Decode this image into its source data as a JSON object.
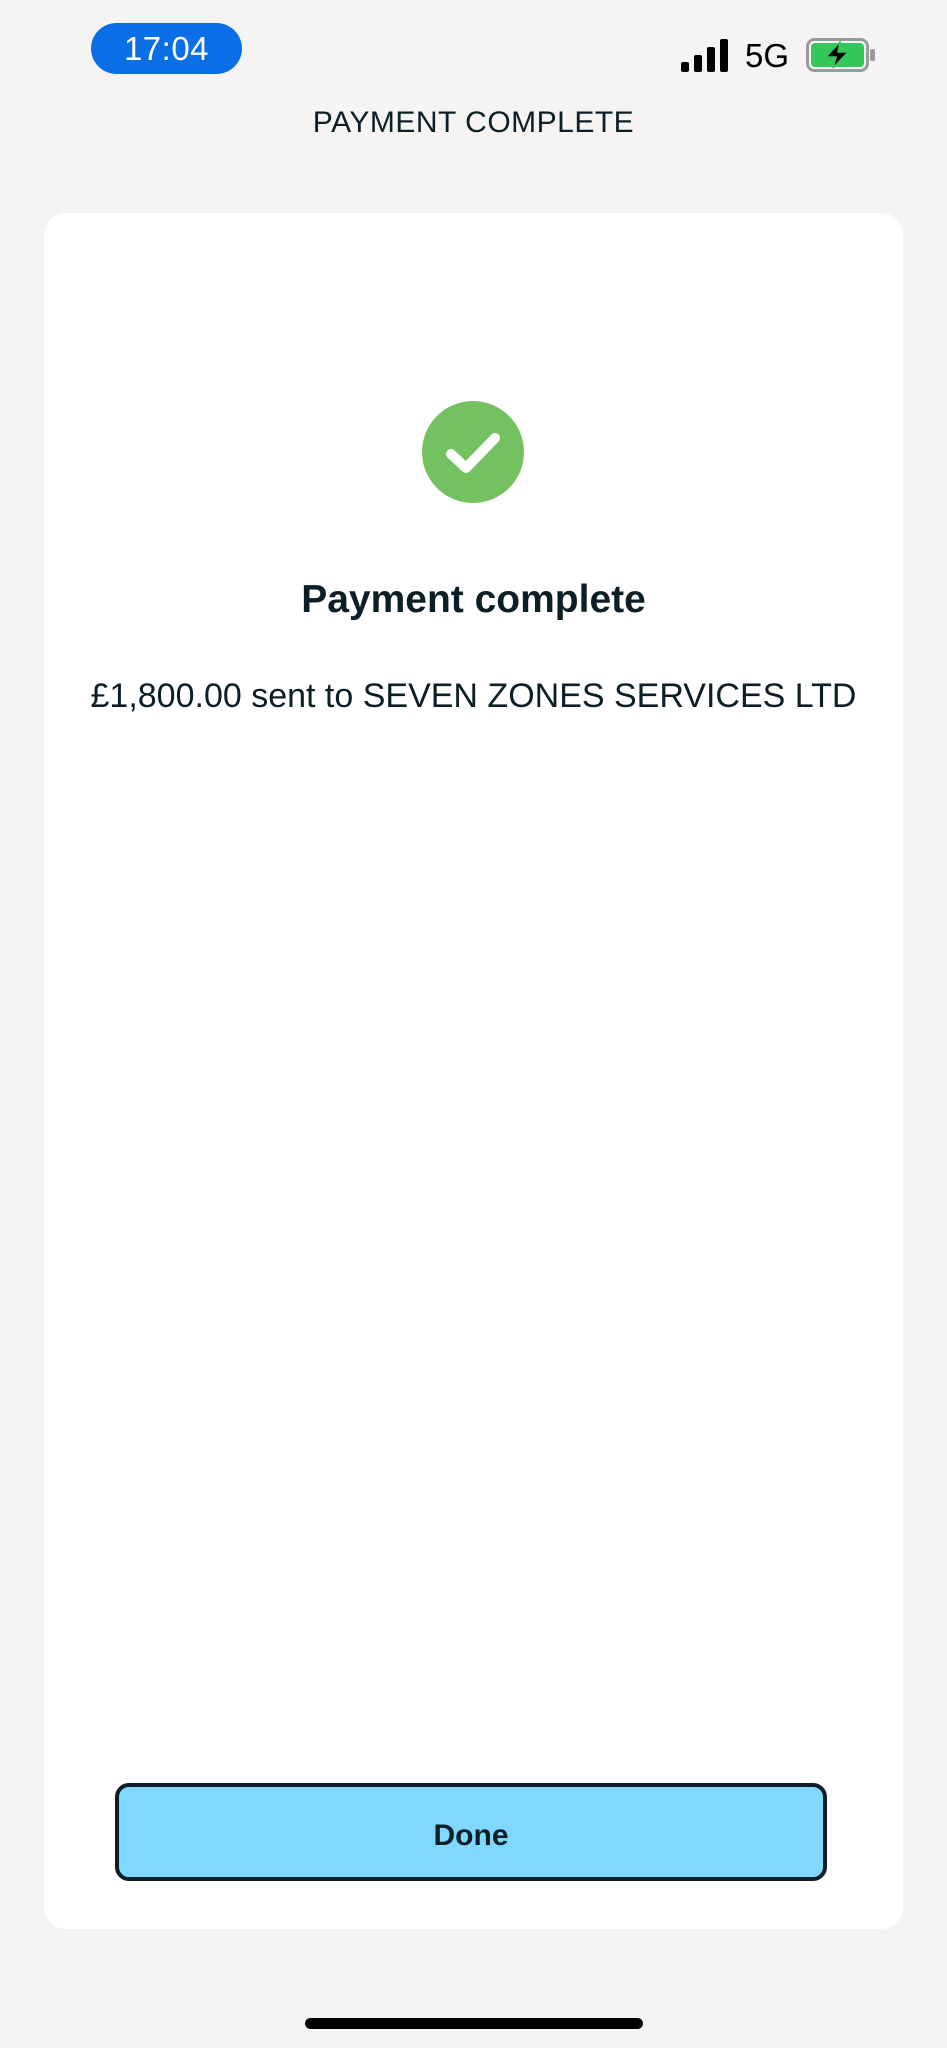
{
  "status_bar": {
    "time": "17:04",
    "network": "5G",
    "signal_icon": "cellular-signal-icon",
    "battery_icon": "battery-charging-icon",
    "time_pill_color": "#0a6ee6",
    "battery_color": "#34c759"
  },
  "header": {
    "title": "PAYMENT COMPLETE"
  },
  "card": {
    "icon": "check-circle-icon",
    "icon_color": "#74c162",
    "title": "Payment complete",
    "subtitle": "£1,800.00 sent to SEVEN ZONES SERVICES LTD"
  },
  "actions": {
    "done_label": "Done",
    "done_color": "#80d8ff"
  }
}
